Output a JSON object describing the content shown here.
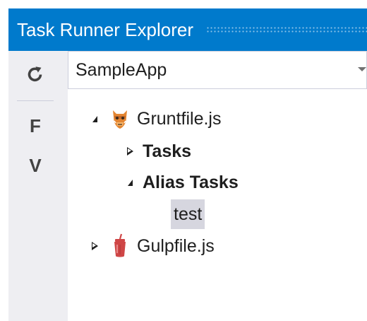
{
  "window": {
    "title": "Task Runner Explorer"
  },
  "toolbar": {
    "refresh_icon": "refresh-icon",
    "button_f": "F",
    "button_v": "V"
  },
  "project_selector": {
    "selected": "SampleApp",
    "arrow_icon": "chevron-down-icon"
  },
  "tree": {
    "gruntfile": {
      "label": "Gruntfile.js",
      "icon": "grunt-boar-icon",
      "expanded": true
    },
    "tasks": {
      "label": "Tasks",
      "expanded": false
    },
    "alias_tasks": {
      "label": "Alias Tasks",
      "expanded": true
    },
    "test": {
      "label": "test",
      "selected": true
    },
    "gulpfile": {
      "label": "Gulpfile.js",
      "icon": "gulp-cup-icon",
      "expanded": false
    }
  },
  "colors": {
    "title_bar": "#007acc",
    "panel_bg": "#eeeef2",
    "selection": "#d6d6df",
    "grunt_orange": "#e48632",
    "gulp_red": "#cf4646"
  }
}
